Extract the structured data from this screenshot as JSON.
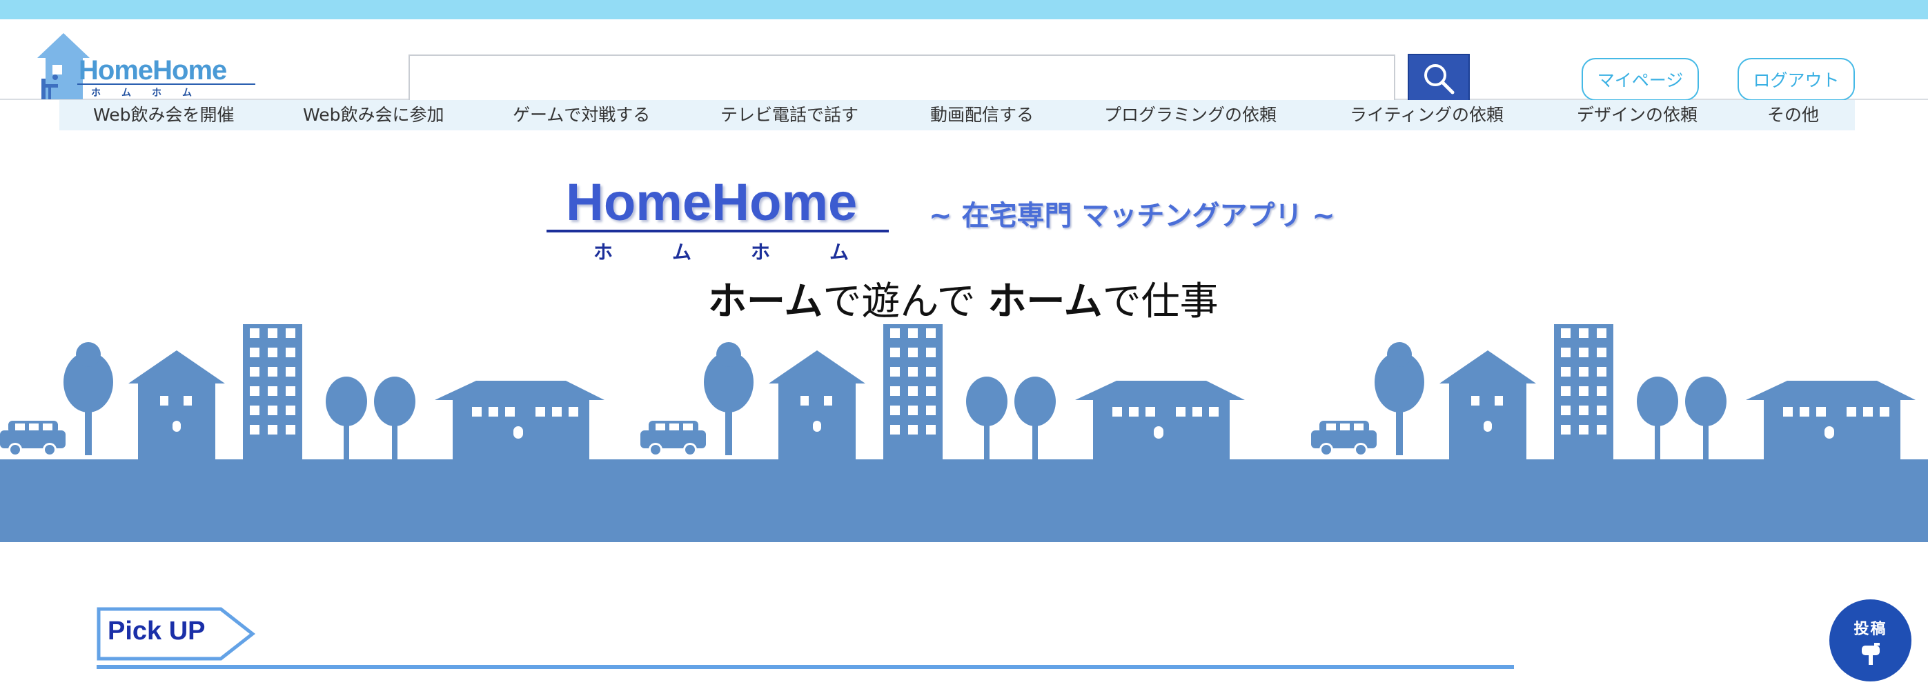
{
  "header": {
    "logo_text": "HomeHome",
    "logo_kana": "ホムホム",
    "search": {
      "value": "",
      "placeholder": ""
    },
    "mypage_label": "マイページ",
    "logout_label": "ログアウト"
  },
  "nav": {
    "items": [
      {
        "label": "Web飲み会を開催"
      },
      {
        "label": "Web飲み会に参加"
      },
      {
        "label": "ゲームで対戦する"
      },
      {
        "label": "テレビ電話で話す"
      },
      {
        "label": "動画配信する"
      },
      {
        "label": "プログラミングの依頼"
      },
      {
        "label": "ライティングの依頼"
      },
      {
        "label": "デザインの依頼"
      },
      {
        "label": "その他"
      }
    ]
  },
  "hero": {
    "logo": "HomeHome",
    "kana": "ホムホム",
    "subtitle": "~ 在宅専門 マッチングアプリ ~",
    "tagline_part1": "ホーム",
    "tagline_part2": "で遊んで ",
    "tagline_part3": "ホーム",
    "tagline_part4": "で仕事"
  },
  "pickup": {
    "label": "Pick UP"
  },
  "post_button": {
    "label": "投稿"
  },
  "colors": {
    "topbar": "#93dcf5",
    "accent_blue": "#2f55b3",
    "link_cyan": "#3ab0e3",
    "city_blue": "#5f8fc6",
    "nav_bg": "#e8f3fa"
  },
  "icons": [
    "house-logo-icon",
    "search-icon",
    "mailbox-icon"
  ]
}
